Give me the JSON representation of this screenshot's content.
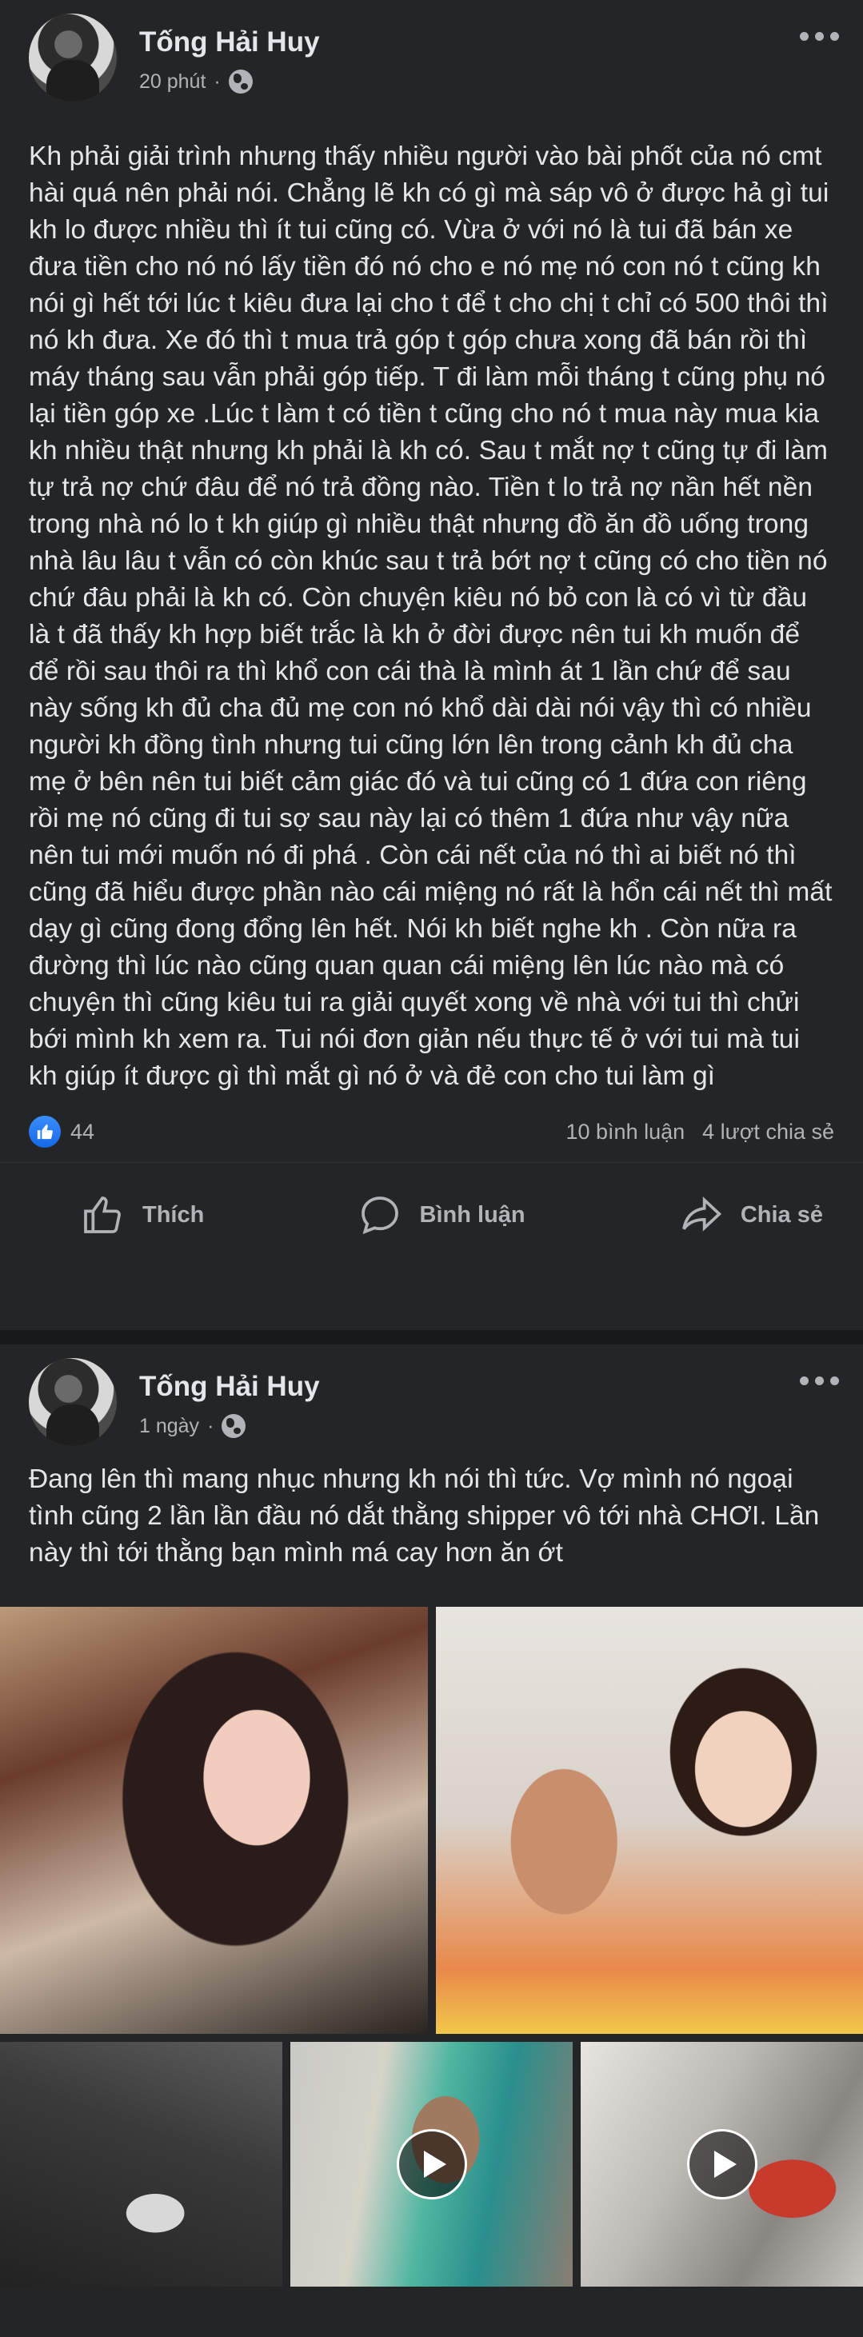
{
  "post1": {
    "author": "Tống Hải Huy",
    "time": "20 phút",
    "text": "Kh phải giải trình nhưng thấy nhiều người vào bài phốt của nó cmt hài quá nên phải nói. Chẳng lẽ kh có gì mà sáp vô ở được hả gì tui kh lo được nhiều thì ít tui cũng có. Vừa ở với nó là tui đã bán xe đưa tiền cho nó nó lấy tiền đó nó cho e nó mẹ nó con nó t cũng kh nói gì hết tới lúc t kiêu đưa lại cho t để t cho chị t chỉ có 500 thôi thì nó kh đưa. Xe đó thì t mua trả góp t góp chưa xong đã bán rồi thì máy tháng sau vẫn phải góp tiếp. T đi làm mỗi tháng t cũng phụ nó lại tiền góp xe .Lúc t làm t có tiền t cũng cho nó t mua này mua kia kh nhiều thật nhưng kh phải là kh có. Sau t mắt nợ t cũng tự đi làm tự trả nợ chứ đâu để nó trả đồng nào. Tiền t lo trả nợ nần hết nền trong nhà nó lo t kh giúp gì nhiều thật nhưng đồ ăn đồ uống trong nhà lâu lâu t vẫn có còn khúc sau t trả bớt nợ t cũng có cho tiền nó chứ đâu phải là kh có. Còn chuyện kiêu nó bỏ con là có vì từ đầu là t đã thấy kh hợp biết trắc là kh ở đời được nên tui kh muốn để để rồi sau thôi ra thì khổ con cái thà là mình át 1 lần chứ để sau này sống kh đủ cha đủ mẹ con nó khổ dài dài nói vậy thì có nhiều người kh đồng tình nhưng tui cũng lớn lên trong cảnh kh đủ cha mẹ ở bên nên tui biết cảm giác đó và tui cũng có 1 đứa con riêng rồi mẹ nó cũng đi tui sợ sau này lại có thêm 1 đứa như vậy nữa nên tui mới muốn nó đi phá . Còn cái nết của nó thì ai biết nó thì cũng đã hiểu được phần nào cái miệng nó rất là hổn cái nết thì mất dạy gì cũng đong đổng lên hết. Nói kh biết nghe kh . Còn nữa ra đường thì lúc nào cũng quan quan cái miệng lên lúc nào mà có chuyện thì cũng kiêu tui ra giải quyết xong về nhà với tui thì chửi bới mình kh xem ra. Tui nói đơn giản nếu thực tế ở với tui mà tui kh giúp ít được gì thì mắt gì nó ở và đẻ con cho tui làm gì",
    "likes": "44",
    "comments": "10 bình luận",
    "shares": "4 lượt chia sẻ"
  },
  "actions": {
    "like": "Thích",
    "comment": "Bình luận",
    "share": "Chia sẻ"
  },
  "post2": {
    "author": "Tống Hải Huy",
    "time": "1 ngày",
    "text": "Đang lên thì mang nhục nhưng kh nói thì tức. Vợ mình nó ngoại tình cũng 2 lần lần đầu nó dắt thằng shipper vô tới nhà CHƠI. Lần này thì tới thằng bạn mình má cay hơn ăn ớt"
  }
}
